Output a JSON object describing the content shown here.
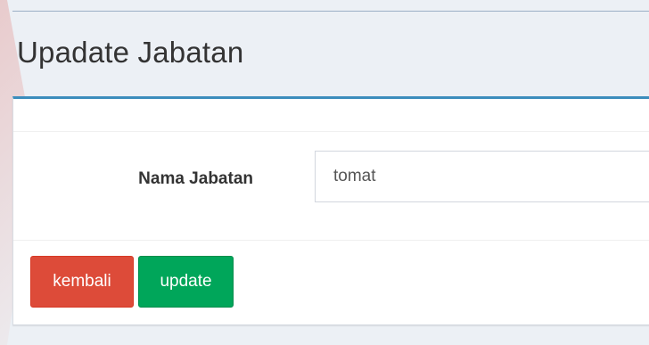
{
  "page": {
    "title": "Upadate Jabatan"
  },
  "form": {
    "nama_jabatan_label": "Nama Jabatan",
    "nama_jabatan_value": "tomat"
  },
  "actions": {
    "back_label": "kembali",
    "update_label": "update"
  },
  "colors": {
    "box_accent": "#3c8dbc",
    "back_button": "#dd4b39",
    "update_button": "#00a65a",
    "page_background": "#ecf0f5"
  }
}
